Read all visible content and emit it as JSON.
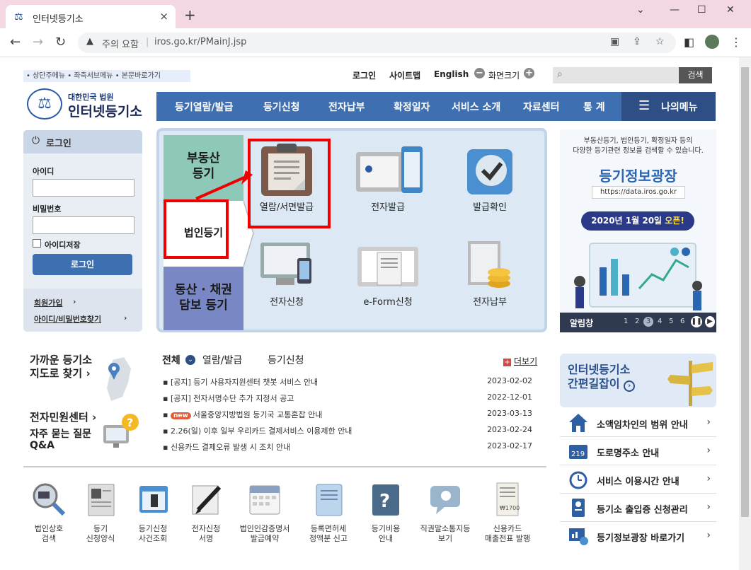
{
  "browser": {
    "tab_title": "인터넷등기소",
    "tab_close": "×",
    "new_tab": "+",
    "win_min": "—",
    "win_max": "☐",
    "win_close": "✕",
    "security_label": "주의 요함",
    "url": "iros.go.kr/PMainJ.jsp"
  },
  "header": {
    "skip_links": "• 상단주메뉴 • 좌측서브메뉴 • 본문바로가기",
    "login": "로그인",
    "sitemap": "사이트맵",
    "english": "English",
    "screen_size": "화면크기",
    "search_button": "검색",
    "logo_small": "대한민국 법원",
    "logo_big": "인터넷등기소"
  },
  "gnb": {
    "items": [
      "등기열람/발급",
      "등기신청",
      "전자납부",
      "확정일자",
      "서비스 소개",
      "자료센터",
      "통 계"
    ],
    "my_menu": "나의메뉴"
  },
  "login_box": {
    "title": "로그인",
    "id_label": "아이디",
    "pw_label": "비밀번호",
    "save_id": "아이디저장",
    "button": "로그인",
    "join": "회원가입",
    "find": "아이디/비밀번호찾기"
  },
  "services": {
    "side_tabs": [
      "부동산\n등기",
      "법인등기",
      "동산 · 채권\n담보 등기"
    ],
    "items": [
      "열람/서면발급",
      "전자발급",
      "발급확인",
      "전자신청",
      "e-Form신청",
      "전자납부"
    ]
  },
  "banner": {
    "line1": "부동산등기, 법인등기, 확정일자 등의",
    "line2": "다양한 등기관련 정보를 검색할 수 있습니다.",
    "title": "등기정보광장",
    "url": "https://data.iros.go.kr",
    "pill_prefix": "2020년 1월 20일 ",
    "pill_bold": "오픈!",
    "alert": "알림창",
    "pages": [
      "1",
      "2",
      "3",
      "4",
      "5",
      "6"
    ]
  },
  "left_links": {
    "nearest": "가까운 등기소\n지도로 찾기 ›",
    "civil": "전자민원센터 ›",
    "faq": "자주 묻는 질문\nQ&A"
  },
  "notice": {
    "tabs": [
      "전체",
      "열람/발급",
      "등기신청"
    ],
    "more": "더보기",
    "badge_new": "new",
    "rows": [
      {
        "title": "[공지] 등기 사용자지원센터 챗봇 서비스 안내",
        "date": "2023-02-02"
      },
      {
        "title": "[공지] 전자서명수단 추가 지정서 공고",
        "date": "2022-12-01"
      },
      {
        "title": "서울중앙지방법원 등기국 교통혼잡 안내",
        "date": "2023-03-13"
      },
      {
        "title": "2.26(일) 이후 일부 우리카드 결제서비스 이용제한 안내",
        "date": "2023-02-24"
      },
      {
        "title": "신용카드 결제오류 발생 시 조치 안내",
        "date": "2023-02-17"
      }
    ]
  },
  "quick": [
    "법인상호\n검색",
    "등기\n신청양식",
    "등기신청\n사건조회",
    "전자신청\n서명",
    "법인인감증명서\n발급예약",
    "등록면허세\n정액분 신고",
    "등기비용\n안내",
    "직권말소통지등\n보기",
    "신용카드\n매출전표 발행"
  ],
  "right": {
    "guide": "인터넷등기소\n간편길잡이",
    "links": [
      "소액임차인의 범위 안내",
      "도로명주소 안내",
      "서비스 이용시간 안내",
      "등기소 출입증 신청관리",
      "등기정보광장 바로가기"
    ]
  },
  "colors": {
    "primary": "#3e70b1",
    "dark": "#2e4f86",
    "highlight": "#ee0000"
  }
}
